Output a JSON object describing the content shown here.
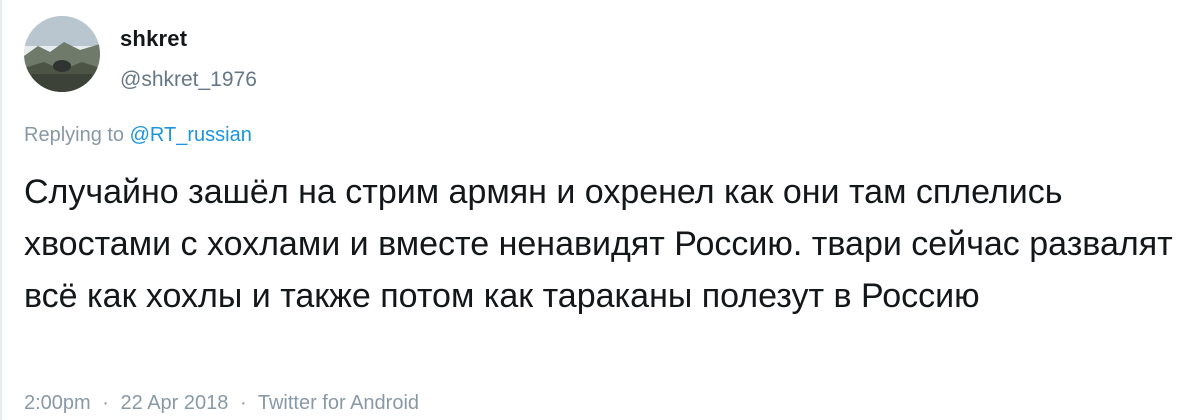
{
  "user": {
    "display_name": "shkret",
    "handle": "@shkret_1976"
  },
  "reply": {
    "prefix": "Replying to",
    "mention": "@RT_russian"
  },
  "tweet": {
    "text": "Случайно зашёл на стрим армян и охренел как они там сплелись хвостами с хохлами и вместе ненавидят Россию. твари сейчас развалят всё как хохлы и также потом как тараканы полезут в Россию"
  },
  "meta": {
    "time": "2:00pm",
    "separator": "·",
    "date": "22 Apr 2018",
    "source": "Twitter for Android"
  },
  "colors": {
    "text": "#14171a",
    "secondary": "#657786",
    "muted": "#8899a6",
    "link": "#1b95e0"
  }
}
